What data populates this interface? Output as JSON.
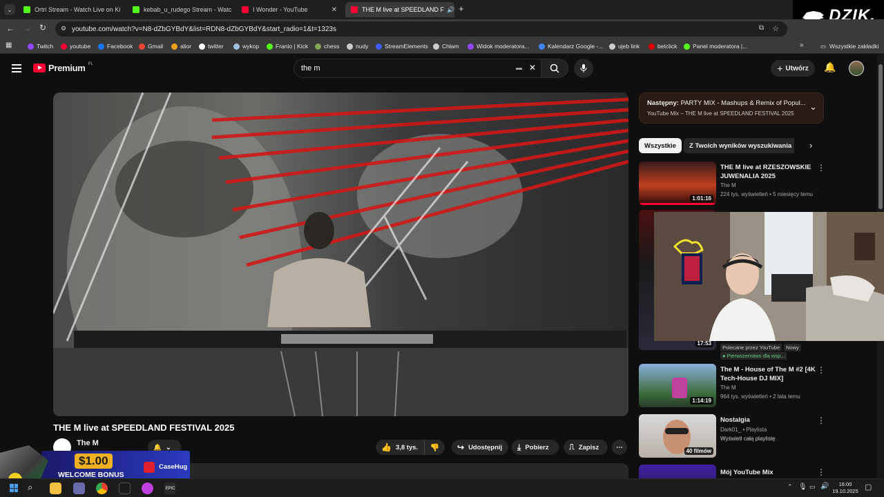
{
  "tabs": [
    {
      "title": "Ortri Stream - Watch Live on Ki",
      "fav": "#53fc18"
    },
    {
      "title": "kebab_u_rudego Stream - Watc",
      "fav": "#53fc18"
    },
    {
      "title": "I Wonder - YouTube",
      "fav": "#ff0033"
    },
    {
      "title": "THE M live at SPEEDLAND F",
      "fav": "#ff0033"
    }
  ],
  "address": {
    "url": "youtube.com/watch?v=N8-dZbGYBdY&list=RDN8-dZbGYBdY&start_radio=1&t=1323s"
  },
  "bookmarks": [
    {
      "label": "Twitch",
      "color": "#9146ff"
    },
    {
      "label": "youtube",
      "color": "#ff0033"
    },
    {
      "label": "Facebook",
      "color": "#1877f2"
    },
    {
      "label": "Gmail",
      "color": "#ea4335"
    },
    {
      "label": "alior",
      "color": "#f0a020"
    },
    {
      "label": "twitter",
      "color": "#ffffff"
    },
    {
      "label": "wykop",
      "color": "#a0c0e0"
    },
    {
      "label": "Franio | Kick",
      "color": "#53fc18"
    },
    {
      "label": "chess",
      "color": "#7fa650"
    },
    {
      "label": "nudy",
      "color": "#cccccc"
    },
    {
      "label": "StreamElements",
      "color": "#3e5bf5"
    },
    {
      "label": "Chłam",
      "color": "#cccccc"
    },
    {
      "label": "Widok moderatora...",
      "color": "#9146ff"
    },
    {
      "label": "Kalendarz Google -...",
      "color": "#4285f4"
    },
    {
      "label": "ujeb link",
      "color": "#cccccc"
    },
    {
      "label": "betclick",
      "color": "#e00000"
    },
    {
      "label": "Panel moderatora |...",
      "color": "#53fc18"
    }
  ],
  "bookmarks_all": "Wszystkie zakładki",
  "brand_logo": "DZIK.",
  "yt": {
    "logo": "Premium",
    "region": "PL",
    "search_value": "the m",
    "create_label": "Utwórz"
  },
  "video": {
    "title": "THE M live at SPEEDLAND FESTIVAL 2025",
    "channel": "The M",
    "likes": "3,8 tys.",
    "share": "Udostępnij",
    "download": "Pobierz",
    "save": "Zapisz"
  },
  "next": {
    "label": "Następny:",
    "title": "PARTY MIX - Mashups & Remix of Popul...",
    "sub": "YouTube Mix – THE M live at SPEEDLAND FESTIVAL 2025"
  },
  "chips": [
    "Wszystkie",
    "Z Twoich wyników wyszukiwania"
  ],
  "recs": [
    {
      "title": "THE M live at RZESZOWSKIE JUWENALIA 2025",
      "channel": "The M",
      "meta": "224 tys. wyświetleń • 5 miesięcy temu",
      "duration": "1:01:16"
    },
    {
      "duration": "17:53",
      "badge1": "Polecane przez YouTube",
      "badge2": "Nowy",
      "priority": "Pierwszeństwo dla wsp..."
    },
    {
      "title": "The M - House of The M #2 [4K Tech-House DJ MIX]",
      "channel": "The M",
      "meta": "964 tys. wyświetleń • 2 lata temu",
      "duration": "1:14:19"
    },
    {
      "title": "Nostalgia",
      "channel": "Dark01_ • Playlista",
      "meta": "Wyświetl całą playlistę",
      "duration": "40 filmów"
    },
    {
      "title": "Mój YouTube Mix"
    }
  ],
  "ad": {
    "amount": "$1.00",
    "text": "WELCOME BONUS",
    "brand": "CaseHug"
  },
  "clock": {
    "time": "16:00",
    "date": "19.10.2025"
  }
}
